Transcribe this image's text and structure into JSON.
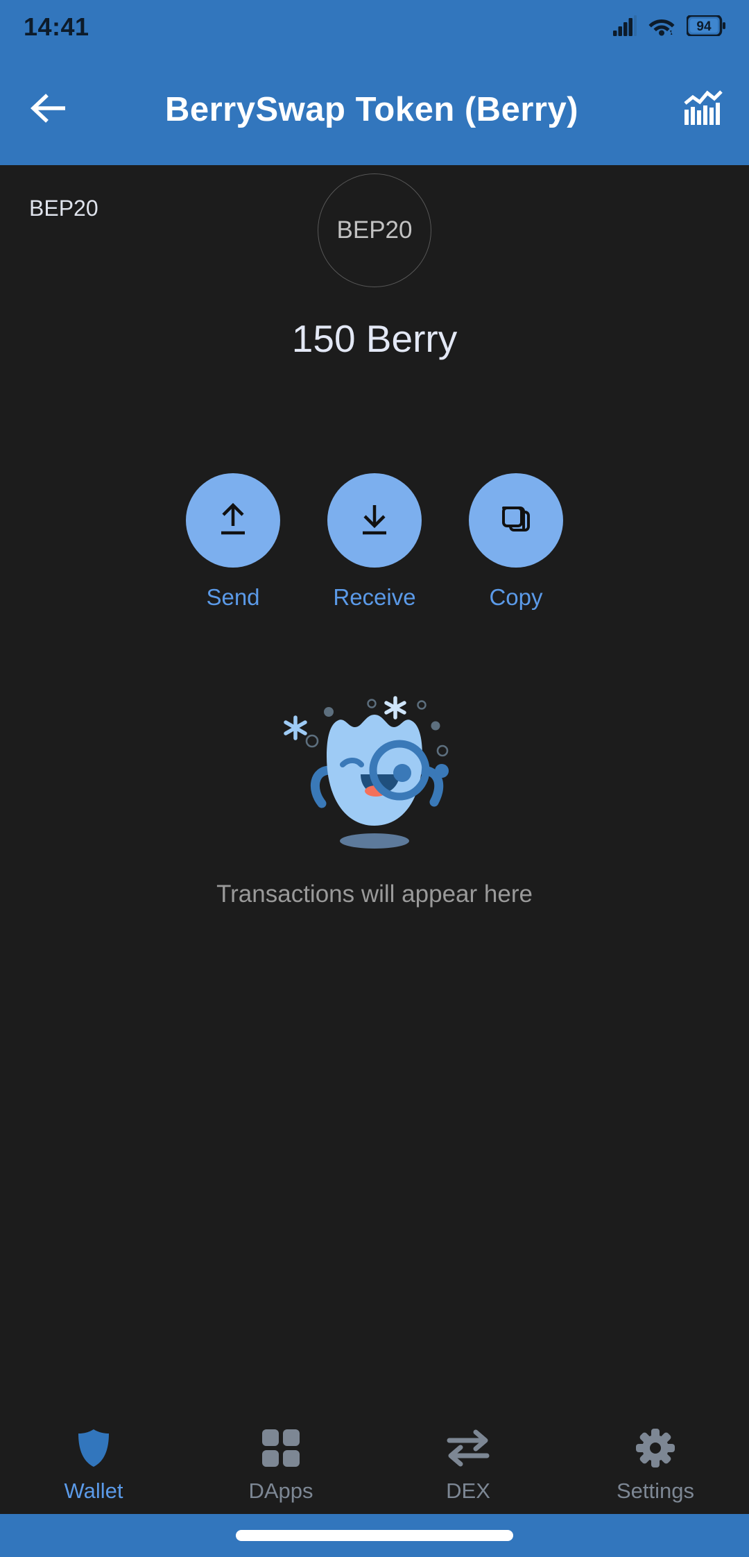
{
  "status_bar": {
    "time": "14:41",
    "battery_level": "94",
    "signal_icon": "cellular-signal-icon",
    "wifi_icon": "wifi-icon",
    "battery_icon": "battery-icon"
  },
  "app_bar": {
    "back_icon": "back-arrow-icon",
    "title": "BerrySwap Token (Berry)",
    "chart_icon": "bar-chart-icon"
  },
  "token": {
    "network_tag": "BEP20",
    "logo_placeholder": "BEP20",
    "balance": "150 Berry"
  },
  "actions": [
    {
      "label": "Send",
      "icon": "upload-arrow-icon"
    },
    {
      "label": "Receive",
      "icon": "download-arrow-icon"
    },
    {
      "label": "Copy",
      "icon": "copy-squares-icon"
    }
  ],
  "empty_state": {
    "illustration": "winking-blob-mascot-with-monocle",
    "message": "Transactions will appear here"
  },
  "bottom_nav": [
    {
      "label": "Wallet",
      "icon": "shield-icon",
      "active": true
    },
    {
      "label": "DApps",
      "icon": "grid-icon",
      "active": false
    },
    {
      "label": "DEX",
      "icon": "swap-arrows-icon",
      "active": false
    },
    {
      "label": "Settings",
      "icon": "gear-icon",
      "active": false
    }
  ],
  "colors": {
    "header_blue": "#3276bd",
    "accent_blue": "#5b9ae8",
    "action_circle": "#7cafee",
    "background": "#1c1c1c",
    "muted_text": "#7d8794",
    "mascot_body": "#9ecbf5",
    "mascot_dark": "#3a79b8",
    "mascot_tongue": "#f4705a"
  }
}
